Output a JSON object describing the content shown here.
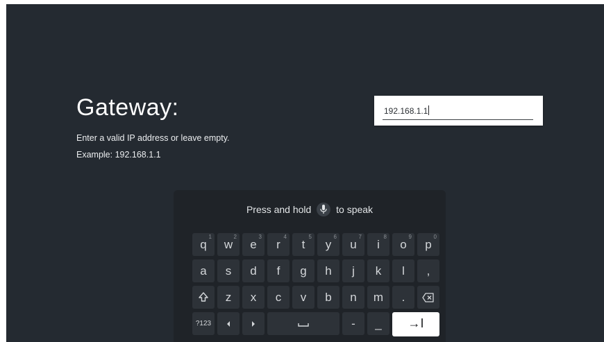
{
  "form": {
    "title": "Gateway:",
    "description": "Enter a valid IP address or leave empty.",
    "example": "Example: 192.168.1.1",
    "input_value": "192.168.1.1"
  },
  "keyboard": {
    "hint_before": "Press and hold",
    "hint_after": "to speak",
    "mic_icon": "microphone-icon",
    "row1": [
      {
        "label": "q",
        "alt": "1"
      },
      {
        "label": "w",
        "alt": "2"
      },
      {
        "label": "e",
        "alt": "3"
      },
      {
        "label": "r",
        "alt": "4"
      },
      {
        "label": "t",
        "alt": "5"
      },
      {
        "label": "y",
        "alt": "6"
      },
      {
        "label": "u",
        "alt": "7"
      },
      {
        "label": "i",
        "alt": "8"
      },
      {
        "label": "o",
        "alt": "9"
      },
      {
        "label": "p",
        "alt": "0"
      }
    ],
    "row2": [
      "a",
      "s",
      "d",
      "f",
      "g",
      "h",
      "j",
      "k",
      "l",
      ","
    ],
    "row3": [
      "z",
      "x",
      "c",
      "v",
      "b",
      "n",
      "m",
      "."
    ],
    "row3_icons": {
      "shift": "shift-icon",
      "backspace": "backspace-icon"
    },
    "row4": {
      "symbols": "?123",
      "left_icon": "arrow-left-icon",
      "right_icon": "arrow-right-icon",
      "space_icon": "space-icon",
      "dash": "-",
      "underscore": "_",
      "enter": "→I"
    },
    "colors": {
      "background": "#242a31",
      "keyboard": "#1f2328",
      "key": "#2d3238",
      "enter_key": "#ffffff"
    }
  }
}
